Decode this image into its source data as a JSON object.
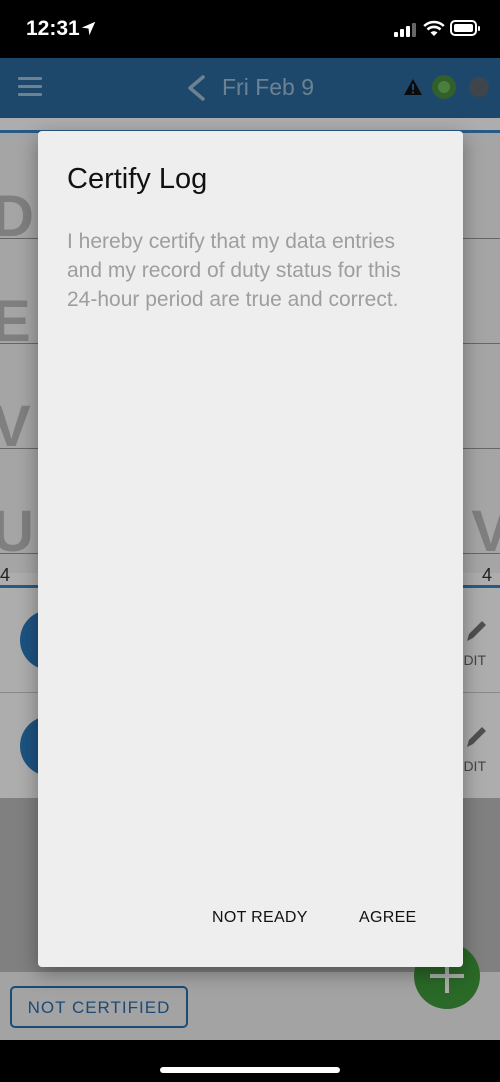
{
  "status_bar": {
    "time": "12:31"
  },
  "header": {
    "date": "Fri Feb 9"
  },
  "background": {
    "hour_left": "4",
    "hour_right": "4",
    "edit_label": "DIT",
    "status_button": "NOT CERTIFIED"
  },
  "dialog": {
    "title": "Certify Log",
    "body": "I hereby certify that my data entries and my record of duty status for this 24-hour period are true and correct.",
    "not_ready_label": "NOT READY",
    "agree_label": "AGREE"
  },
  "colors": {
    "appbar": "#2b6b9e",
    "accent_blue": "#2b6fb0",
    "fab_green": "#3e9b3a",
    "dialog_bg": "#eeeeee"
  }
}
